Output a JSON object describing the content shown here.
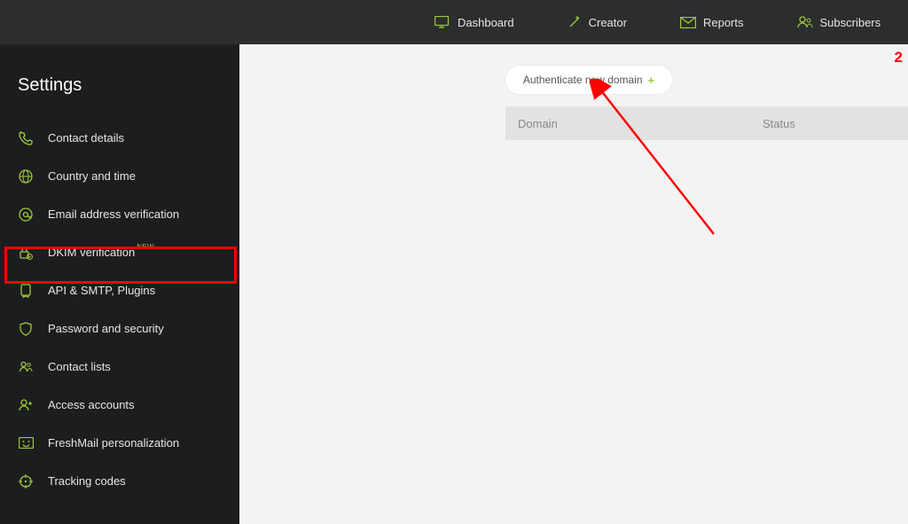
{
  "topnav": {
    "items": [
      {
        "label": "Dashboard",
        "icon": "monitor-icon"
      },
      {
        "label": "Creator",
        "icon": "wand-icon"
      },
      {
        "label": "Reports",
        "icon": "mail-stat-icon"
      },
      {
        "label": "Subscribers",
        "icon": "people-icon"
      }
    ]
  },
  "sidebar": {
    "title": "Settings",
    "items": [
      {
        "label": "Contact details",
        "icon": "phone-icon",
        "active": false
      },
      {
        "label": "Country and time",
        "icon": "globe-icon",
        "active": false
      },
      {
        "label": "Email address verification",
        "icon": "at-icon",
        "active": false
      },
      {
        "label": "DKIM verification",
        "icon": "lock-check-icon",
        "active": true,
        "badge": "NEW"
      },
      {
        "label": "API & SMTP, Plugins",
        "icon": "badge-icon",
        "active": false
      },
      {
        "label": "Password and security",
        "icon": "shield-icon",
        "active": false
      },
      {
        "label": "Contact lists",
        "icon": "people-icon",
        "active": false
      },
      {
        "label": "Access accounts",
        "icon": "person-auth-icon",
        "active": false
      },
      {
        "label": "FreshMail personalization",
        "icon": "mail-face-icon",
        "active": false
      },
      {
        "label": "Tracking codes",
        "icon": "target-icon",
        "active": false
      }
    ]
  },
  "main": {
    "auth_button_label": "Authenticate new domain",
    "table": {
      "col_domain": "Domain",
      "col_status": "Status"
    }
  },
  "annotations": {
    "step_number": "2"
  },
  "colors": {
    "accent": "#9dca3b",
    "annotation": "#ff0000"
  }
}
